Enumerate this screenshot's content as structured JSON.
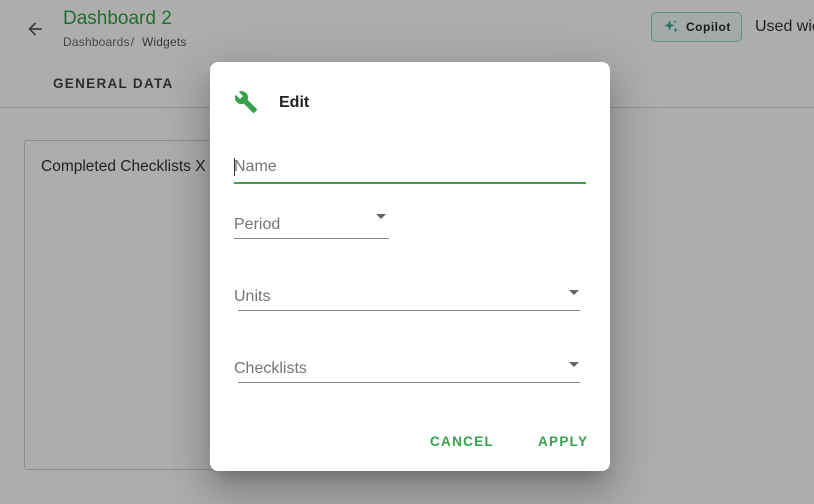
{
  "header": {
    "title": "Dashboard 2",
    "breadcrumb": {
      "parent": "Dashboards",
      "separator": "/",
      "current": "Widgets"
    },
    "copilot_label": "Copilot",
    "used_widgets": "Used wic"
  },
  "tabs": [
    {
      "label": "GENERAL DATA"
    }
  ],
  "widget": {
    "title": "Completed Checklists X"
  },
  "dialog": {
    "title": "Edit",
    "fields": {
      "name_placeholder": "Name",
      "period_label": "Period",
      "units_label": "Units",
      "checklists_label": "Checklists"
    },
    "cancel_label": "CANCEL",
    "apply_label": "APPLY"
  },
  "icons": {
    "back": "arrow-left-icon",
    "copilot": "sparkle-icon",
    "dialog": "wrench-icon",
    "dropdown": "caret-down-icon"
  },
  "colors": {
    "accent": "#36a14b",
    "copilot_border": "#8fd1c5",
    "copilot_icon": "#3aa88f"
  }
}
